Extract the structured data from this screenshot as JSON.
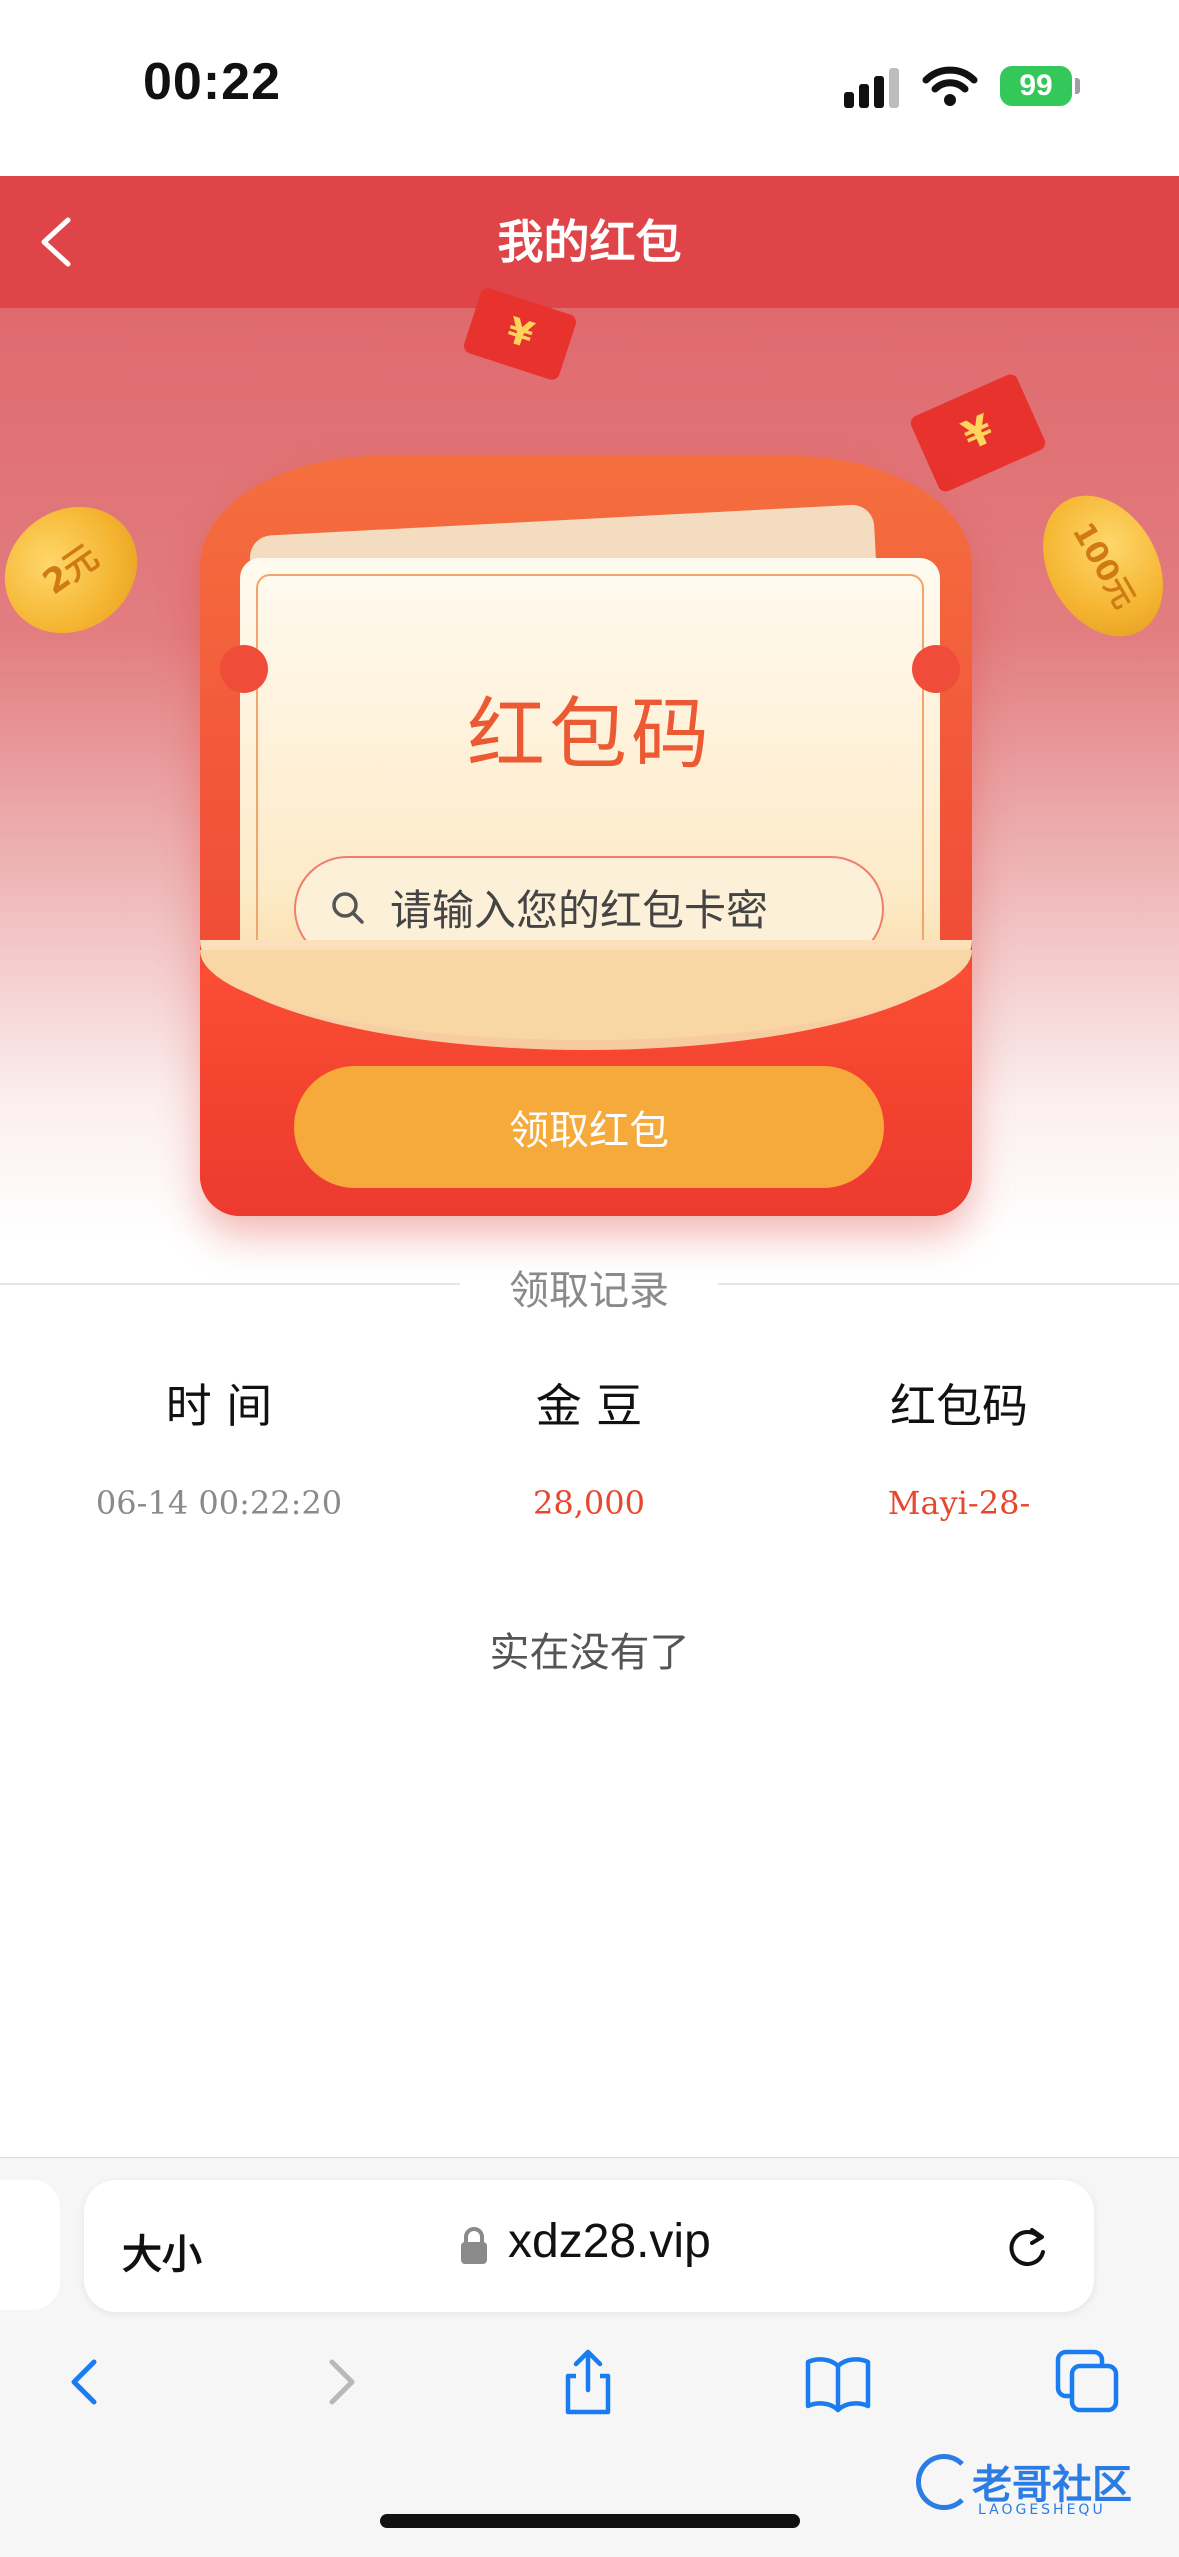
{
  "status_bar": {
    "time": "00:22",
    "battery": "99"
  },
  "header": {
    "title": "我的红包"
  },
  "card": {
    "title": "红包码",
    "input_placeholder": "请输入您的红包卡密",
    "claim_button": "领取红包"
  },
  "records": {
    "section_title": "领取记录",
    "columns": [
      "时 间",
      "金 豆",
      "红包码"
    ],
    "rows": [
      {
        "time": "06-14 00:22:20",
        "beans": "28,000",
        "code": "Mayi-28-"
      }
    ],
    "empty_text": "实在没有了"
  },
  "decor": {
    "coin_left": "2元",
    "coin_right": "100元",
    "packet_symbol": "¥"
  },
  "browser": {
    "text_size": "大小",
    "url": "xdz28.vip"
  },
  "watermark": {
    "text": "老哥社区",
    "subtext": "LAOGESHEQU"
  },
  "colors": {
    "header_red": "#de4448",
    "accent_orange": "#f6aa3b",
    "title_orange": "#ec5a33",
    "value_red": "#e8472e"
  }
}
